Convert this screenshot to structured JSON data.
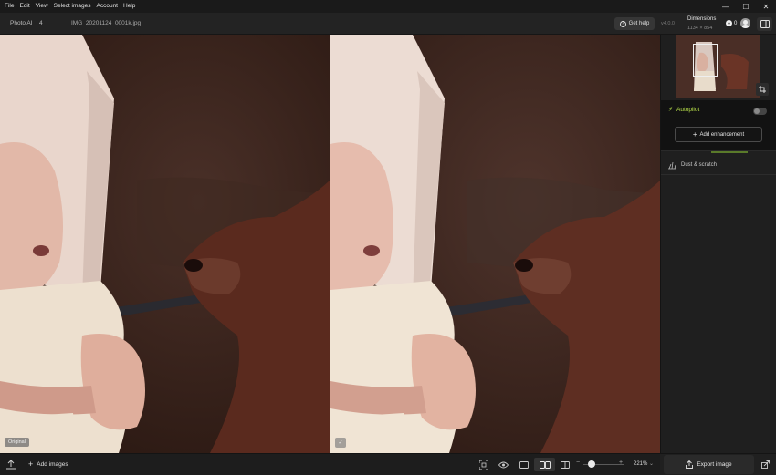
{
  "menu": [
    "File",
    "Edit",
    "View",
    "Select images",
    "Account",
    "Help"
  ],
  "window_controls": {
    "minimize": "—",
    "maximize": "☐",
    "close": "✕"
  },
  "header": {
    "app_name": "Photo AI",
    "image_count": "4",
    "filename": "IMG_20201124_0001k.jpg",
    "help_label": "Get help",
    "version": "v4.0.0",
    "dims_label": "Dimensions",
    "dims_value": "1134 × 854",
    "credits": "0"
  },
  "canvas": {
    "original_tag": "Original",
    "check_tag": "✓"
  },
  "sidepanel": {
    "autopilot_label": "Autopilot",
    "add_enhancement_label": "Add enhancement",
    "dust_label": "Dust & scratch"
  },
  "bottombar": {
    "add_images_label": "Add images",
    "zoom_value": "221%",
    "zoom_minus": "−",
    "zoom_plus": "+",
    "zoom_chevron": "⌄"
  },
  "export": {
    "label": "Export image"
  },
  "colors": {
    "accent": "#b8e04a",
    "background": "#1b1b1b"
  }
}
